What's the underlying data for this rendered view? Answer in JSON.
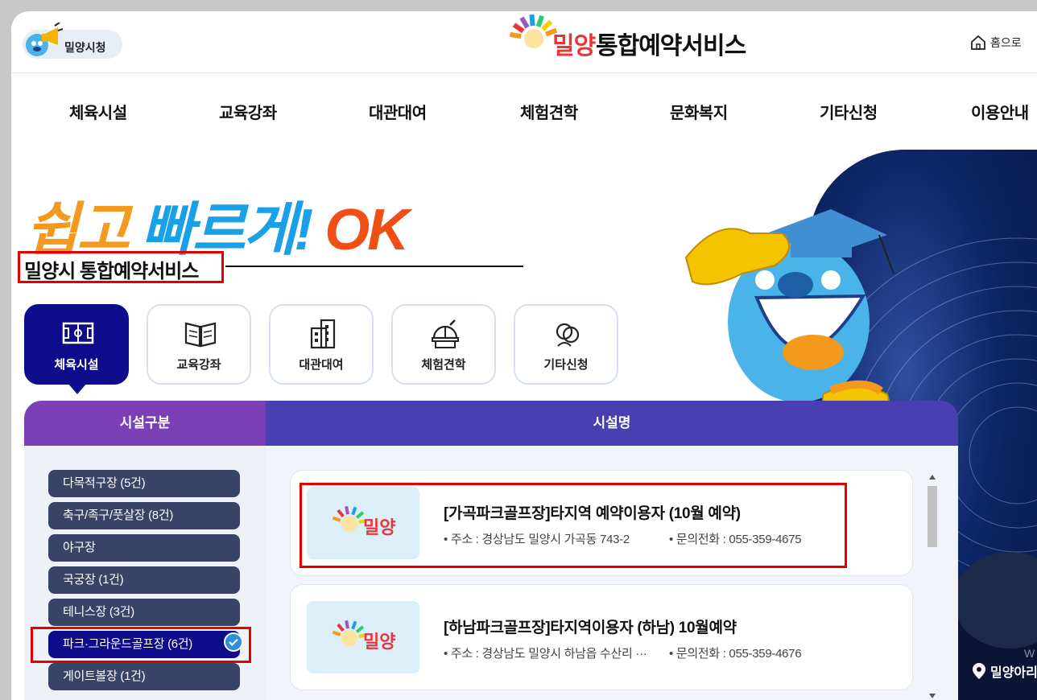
{
  "header": {
    "city_button": "밀양시청",
    "logo_city": "밀양",
    "logo_title": "통합예약서비스",
    "home": "홈으로"
  },
  "nav": {
    "items": [
      "체육시설",
      "교육강좌",
      "대관대여",
      "체험견학",
      "문화복지",
      "기타신청",
      "이용안내"
    ]
  },
  "hero": {
    "slogan_a": "쉽고",
    "slogan_b": "빠르게!",
    "slogan_c": "OK",
    "subtitle": "밀양시 통합예약서비스"
  },
  "categories": [
    {
      "label": "체육시설",
      "icon": "stadium-icon",
      "active": true
    },
    {
      "label": "교육강좌",
      "icon": "book-icon"
    },
    {
      "label": "대관대여",
      "icon": "building-icon"
    },
    {
      "label": "체험견학",
      "icon": "observatory-icon"
    },
    {
      "label": "기타신청",
      "icon": "people-icon"
    }
  ],
  "facility_panel": {
    "left_title": "시설구분",
    "right_title": "시설명",
    "types": [
      "다목적구장 (5건)",
      "축구/족구/풋살장 (8건)",
      "야구장",
      "국궁장 (1건)",
      "테니스장 (3건)",
      "파크·그라운드골프장 (6건)",
      "게이트볼장 (1건)"
    ],
    "selected_index": 5
  },
  "facilities": [
    {
      "logo_city": "밀양",
      "title": "[가곡파크골프장]타지역 예약이용자 (10월 예약)",
      "address": "• 주소 : 경상남도 밀양시 가곡동 743-2",
      "phone": "• 문의전화 : 055-359-4675"
    },
    {
      "logo_city": "밀양",
      "title": "[하남파크골프장]타지역이용자 (하남) 10월예약",
      "address": "• 주소 : 경상남도 밀양시 하남읍 수산리 ···",
      "phone": "• 문의전화 : 055-359-4676"
    }
  ],
  "location": {
    "label": "밀양아리",
    "sub": "W"
  },
  "colors": {
    "active_category": "#0d0d8c",
    "left_header": "#7b3fb6",
    "right_header": "#4a3fb0",
    "facility_button": "#374466",
    "highlight": "#e30000"
  }
}
